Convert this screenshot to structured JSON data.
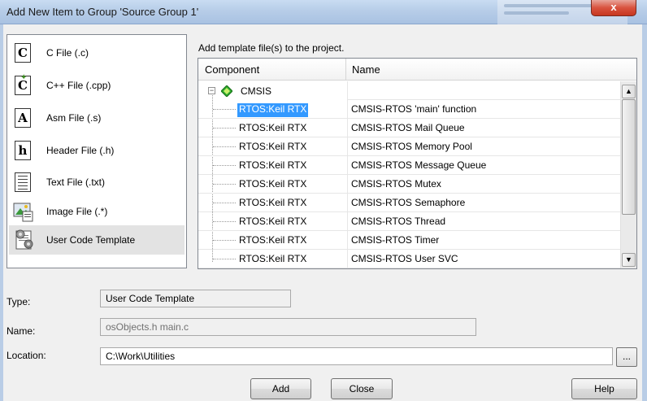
{
  "window": {
    "title": "Add New Item to Group 'Source Group 1'",
    "close_label": "x"
  },
  "file_types": [
    {
      "label": "C File (.c)",
      "icon": "c-file-icon",
      "glyph": "C"
    },
    {
      "label": "C++ File (.cpp)",
      "icon": "cpp-file-icon",
      "glyph": "C"
    },
    {
      "label": "Asm File (.s)",
      "icon": "asm-file-icon",
      "glyph": "A"
    },
    {
      "label": "Header File (.h)",
      "icon": "header-file-icon",
      "glyph": "h"
    },
    {
      "label": "Text File (.txt)",
      "icon": "text-file-icon",
      "glyph": ""
    },
    {
      "label": "Image File (.*)",
      "icon": "image-file-icon",
      "glyph": ""
    },
    {
      "label": "User Code Template",
      "icon": "user-code-template-icon",
      "glyph": ""
    }
  ],
  "selected_file_type": "User Code Template",
  "template_caption": "Add template file(s) to the project.",
  "grid": {
    "columns": [
      "Component",
      "Name"
    ],
    "group": "CMSIS",
    "rows": [
      {
        "component": "RTOS:Keil RTX",
        "name": "CMSIS-RTOS 'main' function"
      },
      {
        "component": "RTOS:Keil RTX",
        "name": "CMSIS-RTOS Mail Queue"
      },
      {
        "component": "RTOS:Keil RTX",
        "name": "CMSIS-RTOS Memory Pool"
      },
      {
        "component": "RTOS:Keil RTX",
        "name": "CMSIS-RTOS Message Queue"
      },
      {
        "component": "RTOS:Keil RTX",
        "name": "CMSIS-RTOS Mutex"
      },
      {
        "component": "RTOS:Keil RTX",
        "name": "CMSIS-RTOS Semaphore"
      },
      {
        "component": "RTOS:Keil RTX",
        "name": "CMSIS-RTOS Thread"
      },
      {
        "component": "RTOS:Keil RTX",
        "name": "CMSIS-RTOS Timer"
      },
      {
        "component": "RTOS:Keil RTX",
        "name": "CMSIS-RTOS User SVC"
      }
    ],
    "selected_row": 0
  },
  "fields": {
    "type_label": "Type:",
    "type_value": "User Code Template",
    "name_label": "Name:",
    "name_value": "osObjects.h main.c",
    "location_label": "Location:",
    "location_value": "C:\\Work\\Utilities",
    "browse_label": "..."
  },
  "buttons": {
    "add": "Add",
    "close": "Close",
    "help": "Help"
  }
}
